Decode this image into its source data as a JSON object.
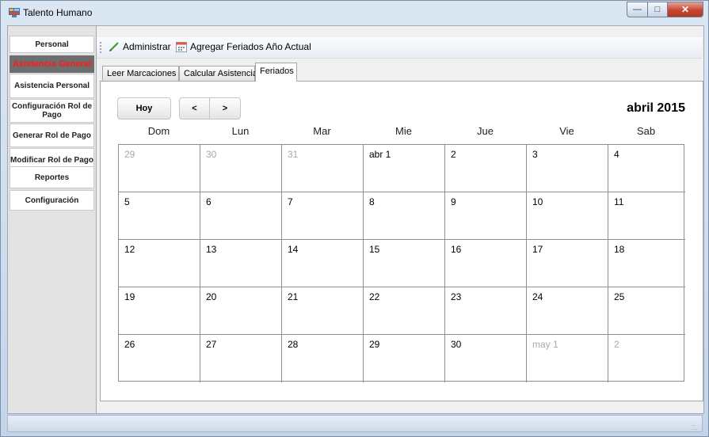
{
  "window": {
    "title": "Talento Humano"
  },
  "sidebar": {
    "items": [
      {
        "label": "Personal"
      },
      {
        "label": "Asistencia General"
      },
      {
        "label": "Asistencia Personal"
      },
      {
        "label": "Configuración Rol de Pago"
      },
      {
        "label": "Generar Rol de Pago"
      },
      {
        "label": "Modificar Rol de Pago"
      },
      {
        "label": "Reportes"
      },
      {
        "label": "Configuración"
      }
    ]
  },
  "toolbar": {
    "administrar_label": "Administrar",
    "feriados_label": "Agregar Feriados Año Actual"
  },
  "tabs": [
    {
      "label": "Leer Marcaciones"
    },
    {
      "label": "Calcular Asistencia"
    },
    {
      "label": "Feriados"
    }
  ],
  "calendar": {
    "today_label": "Hoy",
    "prev_label": "<",
    "next_label": ">",
    "month_label": "abril 2015",
    "days_of_week": [
      "Dom",
      "Lun",
      "Mar",
      "Mie",
      "Jue",
      "Vie",
      "Sab"
    ],
    "weeks": [
      [
        {
          "label": "29",
          "dim": true
        },
        {
          "label": "30",
          "dim": true
        },
        {
          "label": "31",
          "dim": true
        },
        {
          "label": "abr 1",
          "dim": false
        },
        {
          "label": "2",
          "dim": false
        },
        {
          "label": "3",
          "dim": false
        },
        {
          "label": "4",
          "dim": false
        }
      ],
      [
        {
          "label": "5",
          "dim": false
        },
        {
          "label": "6",
          "dim": false
        },
        {
          "label": "7",
          "dim": false
        },
        {
          "label": "8",
          "dim": false
        },
        {
          "label": "9",
          "dim": false
        },
        {
          "label": "10",
          "dim": false
        },
        {
          "label": "11",
          "dim": false
        }
      ],
      [
        {
          "label": "12",
          "dim": false
        },
        {
          "label": "13",
          "dim": false
        },
        {
          "label": "14",
          "dim": false
        },
        {
          "label": "15",
          "dim": false
        },
        {
          "label": "16",
          "dim": false
        },
        {
          "label": "17",
          "dim": false
        },
        {
          "label": "18",
          "dim": false
        }
      ],
      [
        {
          "label": "19",
          "dim": false
        },
        {
          "label": "20",
          "dim": false
        },
        {
          "label": "21",
          "dim": false
        },
        {
          "label": "22",
          "dim": false
        },
        {
          "label": "23",
          "dim": false
        },
        {
          "label": "24",
          "dim": false
        },
        {
          "label": "25",
          "dim": false
        }
      ],
      [
        {
          "label": "26",
          "dim": false
        },
        {
          "label": "27",
          "dim": false
        },
        {
          "label": "28",
          "dim": false
        },
        {
          "label": "29",
          "dim": false
        },
        {
          "label": "30",
          "dim": false
        },
        {
          "label": "may 1",
          "dim": true
        },
        {
          "label": "2",
          "dim": true
        }
      ]
    ]
  }
}
